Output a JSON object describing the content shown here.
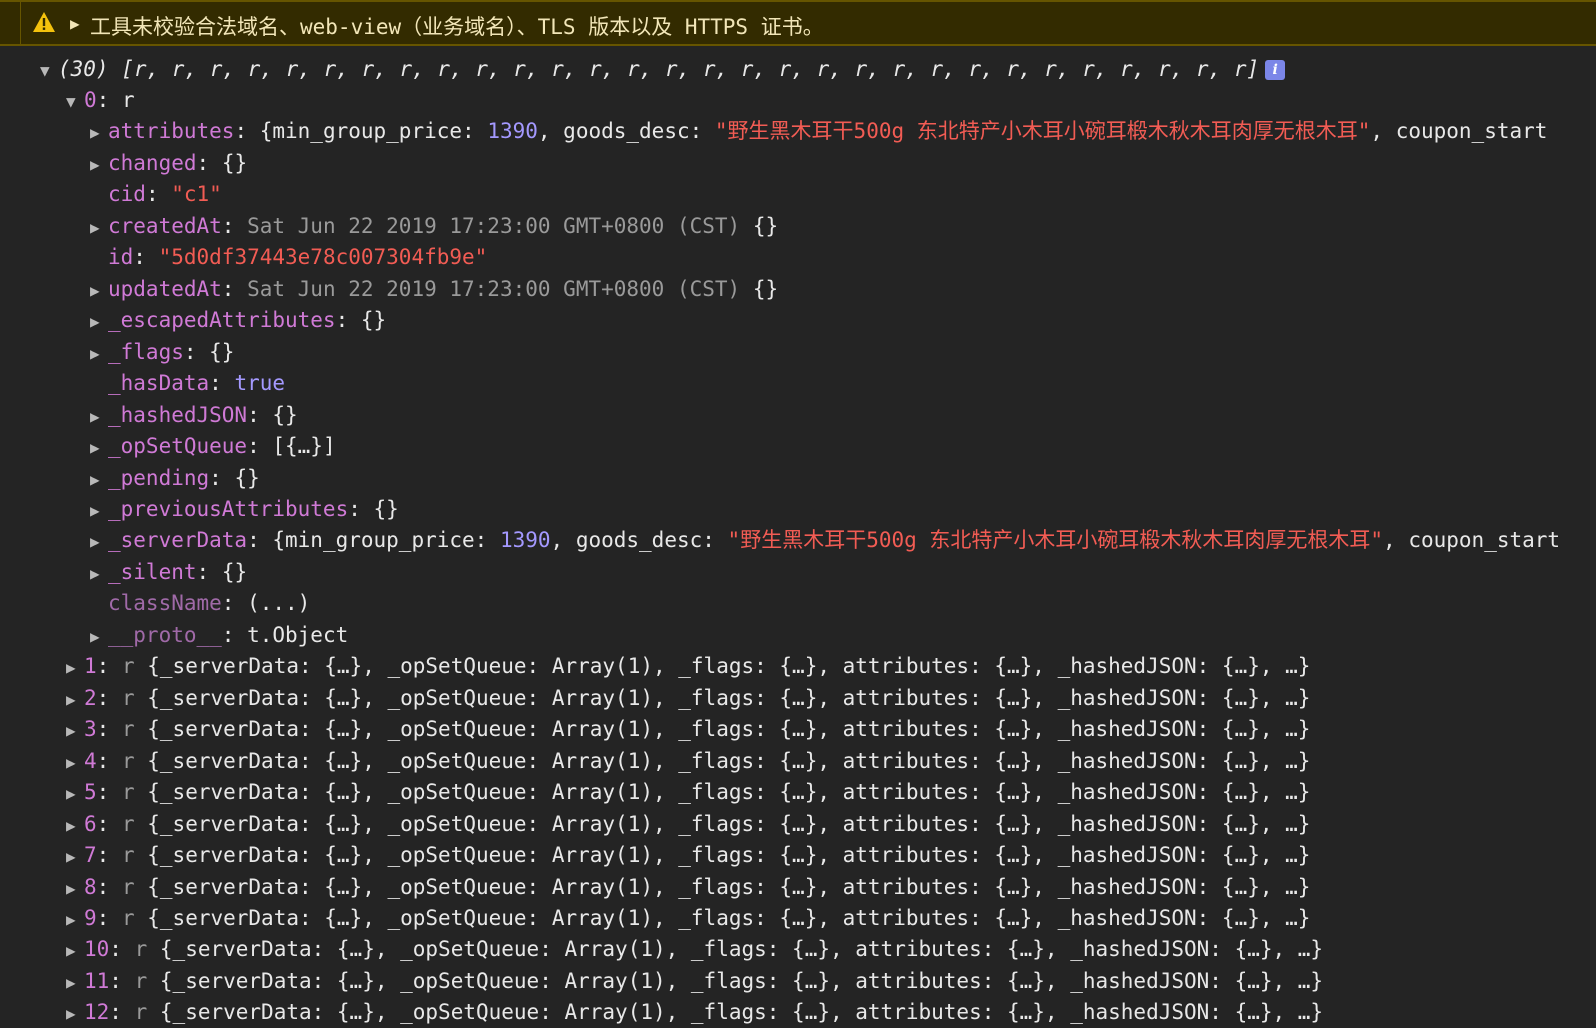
{
  "warning": {
    "text": "工具未校验合法域名、web-view（业务域名）、TLS 版本以及 HTTPS 证书。"
  },
  "array_header": {
    "count": "(30)",
    "preview": "[r, r, r, r, r, r, r, r, r, r, r, r, r, r, r, r, r, r, r, r, r, r, r, r, r, r, r, r, r, r]"
  },
  "item0": {
    "index": "0",
    "type": "r",
    "attributes": {
      "key": "attributes",
      "p1": "{min_group_price: ",
      "price": "1390",
      "p2": ", goods_desc: ",
      "desc": "\"野生黑木耳干500g 东北特产小木耳小碗耳椴木秋木耳肉厚无根木耳\"",
      "p3": ", coupon_start"
    },
    "changed": {
      "key": "changed",
      "val": "{}"
    },
    "cid": {
      "key": "cid",
      "val": "\"c1\""
    },
    "createdAt": {
      "key": "createdAt",
      "date": "Sat Jun 22 2019 17:23:00 GMT+0800 (CST)",
      "tail": " {}"
    },
    "id": {
      "key": "id",
      "val": "\"5d0df37443e78c007304fb9e\""
    },
    "updatedAt": {
      "key": "updatedAt",
      "date": "Sat Jun 22 2019 17:23:00 GMT+0800 (CST)",
      "tail": " {}"
    },
    "escapedAttributes": {
      "key": "_escapedAttributes",
      "val": "{}"
    },
    "flags": {
      "key": "_flags",
      "val": "{}"
    },
    "hasData": {
      "key": "_hasData",
      "val": "true"
    },
    "hashedJSON": {
      "key": "_hashedJSON",
      "val": "{}"
    },
    "opSetQueue": {
      "key": "_opSetQueue",
      "val": "[{…}]"
    },
    "pending": {
      "key": "_pending",
      "val": "{}"
    },
    "previousAttributes": {
      "key": "_previousAttributes",
      "val": "{}"
    },
    "serverData": {
      "key": "_serverData",
      "p1": "{min_group_price: ",
      "price": "1390",
      "p2": ", goods_desc: ",
      "desc": "\"野生黑木耳干500g 东北特产小木耳小碗耳椴木秋木耳肉厚无根木耳\"",
      "p3": ", coupon_start"
    },
    "silent": {
      "key": "_silent",
      "val": "{}"
    },
    "className": {
      "key": "className",
      "val": "(...)"
    },
    "proto": {
      "key": "__proto__",
      "val": "t.Object"
    }
  },
  "collapsed_items": [
    {
      "index": "1",
      "type": "r",
      "summary": "{_serverData: {…}, _opSetQueue: Array(1), _flags: {…}, attributes: {…}, _hashedJSON: {…}, …}"
    },
    {
      "index": "2",
      "type": "r",
      "summary": "{_serverData: {…}, _opSetQueue: Array(1), _flags: {…}, attributes: {…}, _hashedJSON: {…}, …}"
    },
    {
      "index": "3",
      "type": "r",
      "summary": "{_serverData: {…}, _opSetQueue: Array(1), _flags: {…}, attributes: {…}, _hashedJSON: {…}, …}"
    },
    {
      "index": "4",
      "type": "r",
      "summary": "{_serverData: {…}, _opSetQueue: Array(1), _flags: {…}, attributes: {…}, _hashedJSON: {…}, …}"
    },
    {
      "index": "5",
      "type": "r",
      "summary": "{_serverData: {…}, _opSetQueue: Array(1), _flags: {…}, attributes: {…}, _hashedJSON: {…}, …}"
    },
    {
      "index": "6",
      "type": "r",
      "summary": "{_serverData: {…}, _opSetQueue: Array(1), _flags: {…}, attributes: {…}, _hashedJSON: {…}, …}"
    },
    {
      "index": "7",
      "type": "r",
      "summary": "{_serverData: {…}, _opSetQueue: Array(1), _flags: {…}, attributes: {…}, _hashedJSON: {…}, …}"
    },
    {
      "index": "8",
      "type": "r",
      "summary": "{_serverData: {…}, _opSetQueue: Array(1), _flags: {…}, attributes: {…}, _hashedJSON: {…}, …}"
    },
    {
      "index": "9",
      "type": "r",
      "summary": "{_serverData: {…}, _opSetQueue: Array(1), _flags: {…}, attributes: {…}, _hashedJSON: {…}, …}"
    },
    {
      "index": "10",
      "type": "r",
      "summary": "{_serverData: {…}, _opSetQueue: Array(1), _flags: {…}, attributes: {…}, _hashedJSON: {…}, …}"
    },
    {
      "index": "11",
      "type": "r",
      "summary": "{_serverData: {…}, _opSetQueue: Array(1), _flags: {…}, attributes: {…}, _hashedJSON: {…}, …}"
    },
    {
      "index": "12",
      "type": "r",
      "summary": "{_serverData: {…}, _opSetQueue: Array(1), _flags: {…}, attributes: {…}, _hashedJSON: {…}, …}"
    }
  ]
}
